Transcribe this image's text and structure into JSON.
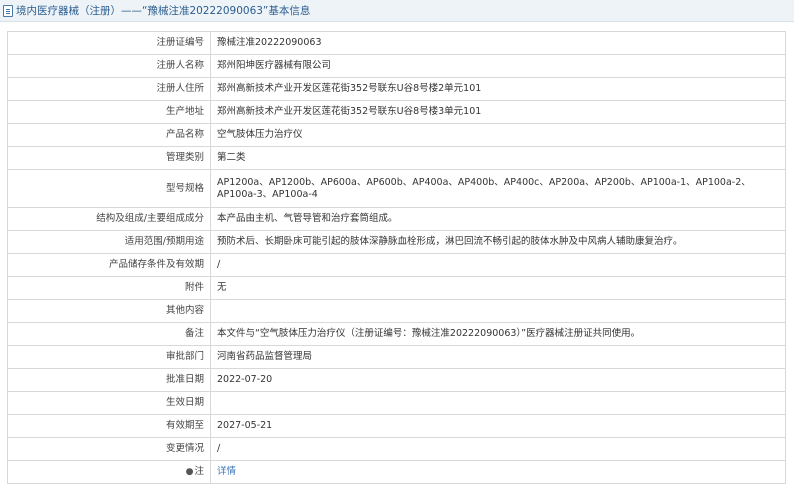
{
  "header": {
    "icon": "document-icon",
    "title": "境内医疗器械（注册）——“豫械注准20222090063”基本信息"
  },
  "rows": [
    {
      "label": "注册证编号",
      "value": "豫械注准20222090063"
    },
    {
      "label": "注册人名称",
      "value": "郑州阳坤医疗器械有限公司"
    },
    {
      "label": "注册人住所",
      "value": "郑州高新技术产业开发区莲花街352号联东U谷8号楼2单元101"
    },
    {
      "label": "生产地址",
      "value": "郑州高新技术产业开发区莲花街352号联东U谷8号楼3单元101"
    },
    {
      "label": "产品名称",
      "value": "空气肢体压力治疗仪"
    },
    {
      "label": "管理类别",
      "value": "第二类"
    },
    {
      "label": "型号规格",
      "value": "AP1200a、AP1200b、AP600a、AP600b、AP400a、AP400b、AP400c、AP200a、AP200b、AP100a-1、AP100a-2、AP100a-3、AP100a-4"
    },
    {
      "label": "结构及组成/主要组成成分",
      "value": "本产品由主机、气管导管和治疗套筒组成。"
    },
    {
      "label": "适用范围/预期用途",
      "value": "预防术后、长期卧床可能引起的肢体深静脉血栓形成，淋巴回流不畅引起的肢体水肿及中风病人辅助康复治疗。"
    },
    {
      "label": "产品储存条件及有效期",
      "value": "/"
    },
    {
      "label": "附件",
      "value": "无"
    },
    {
      "label": "其他内容",
      "value": ""
    },
    {
      "label": "备注",
      "value": "本文件与“空气肢体压力治疗仪（注册证编号：豫械注准20222090063）”医疗器械注册证共同使用。"
    },
    {
      "label": "审批部门",
      "value": "河南省药品监督管理局"
    },
    {
      "label": "批准日期",
      "value": "2022-07-20"
    },
    {
      "label": "生效日期",
      "value": ""
    },
    {
      "label": "有效期至",
      "value": "2027-05-21"
    },
    {
      "label": "变更情况",
      "value": "/"
    }
  ],
  "note_row": {
    "pin_icon": "●",
    "label": "注",
    "link": "详情"
  },
  "colors": {
    "header_bg": "#eef3f8",
    "title": "#2a5d8f",
    "border": "#d8d8d8",
    "link": "#3b74b8"
  }
}
